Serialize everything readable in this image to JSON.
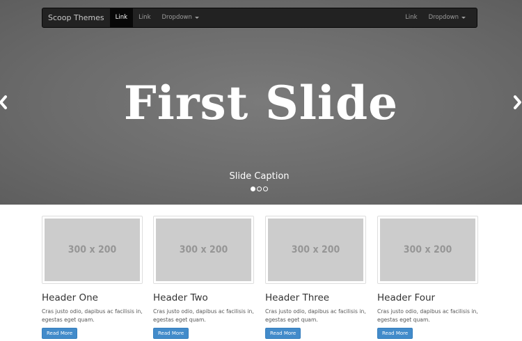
{
  "navbar": {
    "brand": "Scoop Themes",
    "left_links": [
      {
        "label": "Link",
        "active": true
      },
      {
        "label": "Link",
        "active": false
      },
      {
        "label": "Dropdown",
        "dropdown": true
      }
    ],
    "right_links": [
      {
        "label": "Link"
      },
      {
        "label": "Dropdown",
        "dropdown": true
      }
    ]
  },
  "carousel": {
    "title": "First Slide",
    "caption": "Slide Caption",
    "slides_total": 3,
    "active_index": 0
  },
  "cards": [
    {
      "image_label": "300 x 200",
      "title": "Header One",
      "text": "Cras justo odio, dapibus ac facilisis in, egestas eget quam.",
      "button": "Read More"
    },
    {
      "image_label": "300 x 200",
      "title": "Header Two",
      "text": "Cras justo odio, dapibus ac facilisis in, egestas eget quam.",
      "button": "Read More"
    },
    {
      "image_label": "300 x 200",
      "title": "Header Three",
      "text": "Cras justo odio, dapibus ac facilisis in, egestas eget quam.",
      "button": "Read More"
    },
    {
      "image_label": "300 x 200",
      "title": "Header Four",
      "text": "Cras justo odio, dapibus ac facilisis in, egestas eget quam.",
      "button": "Read More"
    }
  ],
  "colors": {
    "navbar_bg": "#222222",
    "primary_button": "#428bca",
    "placeholder_bg": "#cccccc"
  }
}
